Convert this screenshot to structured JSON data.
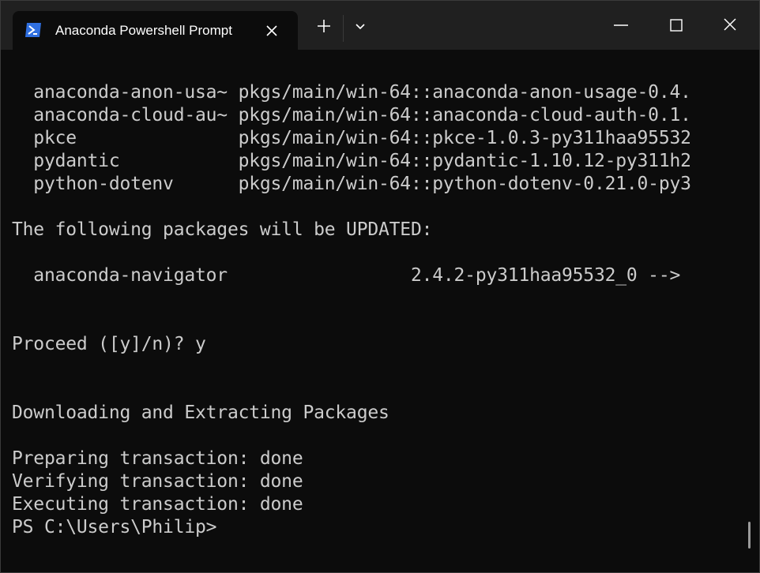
{
  "window": {
    "tab_title": "Anaconda Powershell Prompt",
    "tab_icon": "powershell-icon",
    "buttons": {
      "close_tab": "close-icon",
      "new_tab": "plus-icon",
      "dropdown": "chevron-down-icon",
      "minimize": "minimize-icon",
      "maximize": "maximize-icon",
      "close": "close-icon"
    }
  },
  "terminal": {
    "lines": [
      "  anaconda-anon-usa~ pkgs/main/win-64::anaconda-anon-usage-0.4.",
      "  anaconda-cloud-au~ pkgs/main/win-64::anaconda-cloud-auth-0.1.",
      "  pkce               pkgs/main/win-64::pkce-1.0.3-py311haa95532",
      "  pydantic           pkgs/main/win-64::pydantic-1.10.12-py311h2",
      "  python-dotenv      pkgs/main/win-64::python-dotenv-0.21.0-py3",
      "",
      "The following packages will be UPDATED:",
      "",
      "  anaconda-navigator                 2.4.2-py311haa95532_0 -->",
      "",
      "",
      "Proceed ([y]/n)? y",
      "",
      "",
      "Downloading and Extracting Packages",
      "",
      "Preparing transaction: done",
      "Verifying transaction: done",
      "Executing transaction: done",
      "PS C:\\Users\\Philip>"
    ]
  },
  "colors": {
    "background": "#0c0c0c",
    "titlebar": "#202020",
    "text": "#cccccc",
    "accent": "#2f6fe0"
  }
}
